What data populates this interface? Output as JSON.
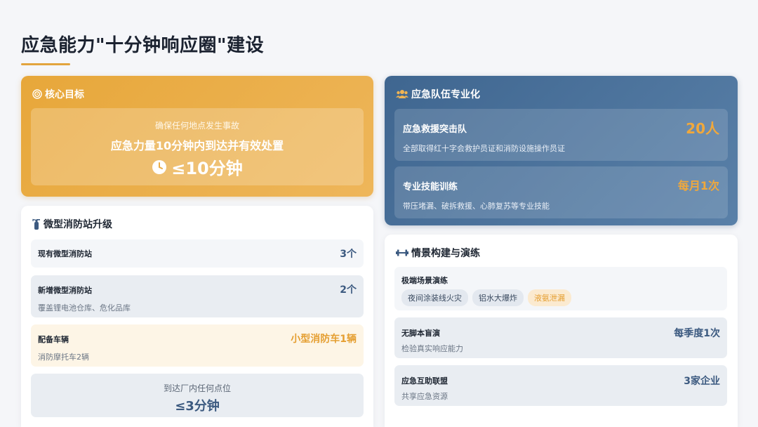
{
  "title": "应急能力\"十分钟响应圈\"建设",
  "colors": {
    "accent_orange": "#e7a73a",
    "accent_blue": "#3f6690",
    "value_blue": "#3c5a80"
  },
  "core": {
    "heading": "核心目标",
    "icon": "target-icon",
    "sub": "确保任何地点发生事故",
    "main": "应急力量10分钟内到达并有效处置",
    "big_icon": "clock-icon",
    "big": "≤10分钟"
  },
  "team": {
    "heading": "应急队伍专业化",
    "icon": "team-icon",
    "items": [
      {
        "name": "应急救援突击队",
        "desc": "全部取得红十字会救护员证和消防设施操作员证",
        "value": "20人"
      },
      {
        "name": "专业技能训练",
        "desc": "带压堵漏、破拆救援、心肺复苏等专业技能",
        "value": "每月1次"
      }
    ]
  },
  "station": {
    "heading": "微型消防站升级",
    "icon": "fire-extinguisher-icon",
    "rows": [
      {
        "name": "现有微型消防站",
        "value": "3个"
      },
      {
        "name": "新增微型消防站",
        "desc": "覆盖锂电池仓库、危化品库",
        "value": "2个"
      },
      {
        "name": "配备车辆",
        "desc": "消防摩托车2辆",
        "value": "小型消防车1辆"
      }
    ],
    "reach_sub": "到达厂内任何点位",
    "reach_big": "≤3分钟"
  },
  "scene": {
    "heading": "情景构建与演练",
    "icon": "dumbbell-icon",
    "extreme": {
      "name": "极端场景演练",
      "chips": [
        "夜间涂装线火灾",
        "铝水大爆炸",
        "液氨泄漏"
      ]
    },
    "rows": [
      {
        "name": "无脚本盲演",
        "desc": "检验真实响应能力",
        "value": "每季度1次"
      },
      {
        "name": "应急互助联盟",
        "desc": "共享应急资源",
        "value": "3家企业"
      }
    ]
  }
}
